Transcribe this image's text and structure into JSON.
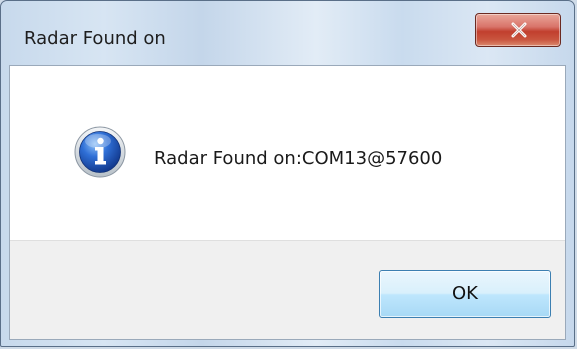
{
  "window": {
    "title": "Radar Found on",
    "close_icon": "close-icon",
    "close_color": "#c13f2e"
  },
  "content": {
    "icon": "information-icon",
    "message": "Radar Found on:COM13@57600"
  },
  "footer": {
    "ok_label": "OK"
  }
}
